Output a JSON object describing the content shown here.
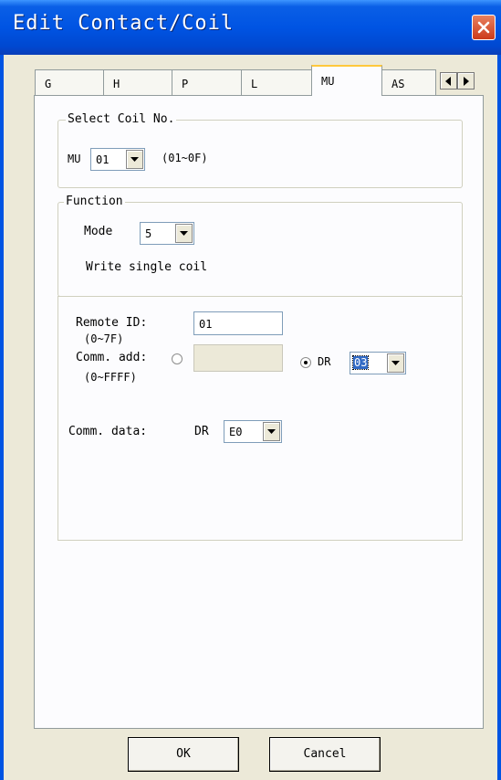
{
  "window": {
    "title": "Edit Contact/Coil"
  },
  "tabs": [
    {
      "label": "G"
    },
    {
      "label": "H"
    },
    {
      "label": "P"
    },
    {
      "label": "L"
    },
    {
      "label": "MU"
    },
    {
      "label": "AS"
    }
  ],
  "active_tab": "MU",
  "select_coil": {
    "title": "Select Coil No.",
    "prefix": "MU",
    "value": "01",
    "range": "(01~0F)"
  },
  "function": {
    "title": "Function",
    "mode_label": "Mode",
    "mode_value": "5",
    "description": "Write single coil"
  },
  "params": {
    "remote_id_label": "Remote ID:",
    "remote_id_range": "(0~7F)",
    "remote_id_value": "01",
    "comm_add_label": "Comm. add:",
    "comm_add_range": "(0~FFFF)",
    "comm_add_value": "",
    "dr_label": "DR",
    "dr_value": "03",
    "comm_data_label": "Comm. data:",
    "comm_data_dr_label": "DR",
    "comm_data_value": "E0"
  },
  "buttons": {
    "ok": "OK",
    "cancel": "Cancel"
  },
  "colors": {
    "titlebar": "#0054e3",
    "close": "#cc3a1a",
    "selection": "#316ac5",
    "active_tab_highlight": "#ffc83c"
  }
}
